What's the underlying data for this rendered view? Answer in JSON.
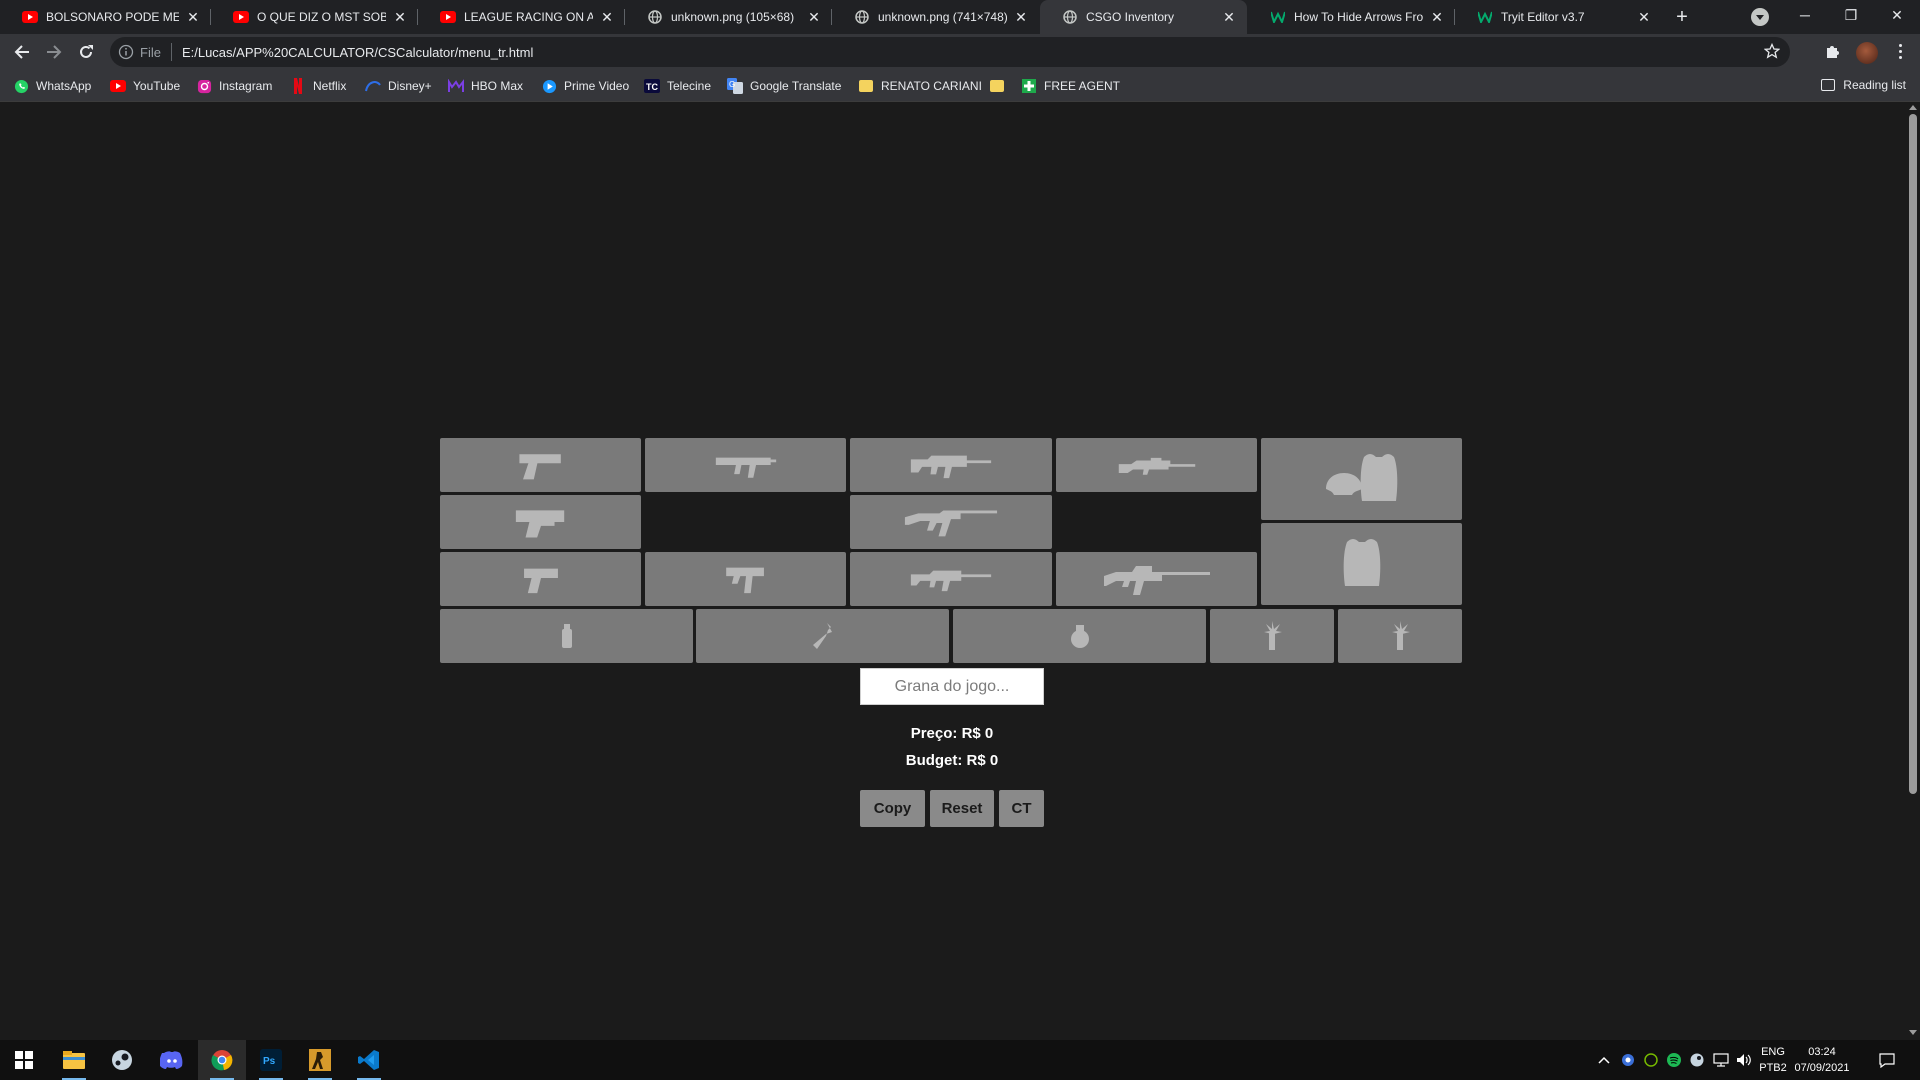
{
  "browser": {
    "tabs": [
      {
        "title": "BOLSONARO PODE MESMO",
        "favicon": "youtube-icon"
      },
      {
        "title": "O QUE DIZ O MST SOBRE O",
        "favicon": "youtube-icon"
      },
      {
        "title": "LEAGUE RACING ON A WE",
        "favicon": "youtube-icon"
      },
      {
        "title": "unknown.png (105×68)",
        "favicon": "globe-icon"
      },
      {
        "title": "unknown.png (741×748)",
        "favicon": "globe-icon"
      },
      {
        "title": "CSGO Inventory",
        "favicon": "globe-icon",
        "active": true
      },
      {
        "title": "How To Hide Arrows From",
        "favicon": "w-icon"
      },
      {
        "title": "Tryit Editor v3.7",
        "favicon": "w-icon"
      }
    ],
    "address": {
      "scheme": "File",
      "url": "E:/Lucas/APP%20CALCULATOR/CSCalculator/menu_tr.html"
    },
    "bookmarks": [
      {
        "label": "WhatsApp",
        "icon": "whatsapp-icon"
      },
      {
        "label": "YouTube",
        "icon": "youtube-icon"
      },
      {
        "label": "Instagram",
        "icon": "instagram-icon"
      },
      {
        "label": "Netflix",
        "icon": "netflix-icon"
      },
      {
        "label": "Disney+",
        "icon": "disney-icon"
      },
      {
        "label": "HBO Max",
        "icon": "hbo-icon"
      },
      {
        "label": "Prime Video",
        "icon": "prime-icon"
      },
      {
        "label": "Telecine",
        "icon": "telecine-icon"
      },
      {
        "label": "Google Translate",
        "icon": "translate-icon"
      },
      {
        "label": "RENATO CARIANI",
        "icon": "folder-icon"
      },
      {
        "label": "",
        "icon": "folder-icon"
      },
      {
        "label": "FREE AGENT",
        "icon": "cross-icon"
      }
    ],
    "reading_list": "Reading list"
  },
  "app": {
    "money_placeholder": "Grana do jogo...",
    "price_label": "Preço: R$ 0",
    "budget_label": "Budget: R$ 0",
    "buttons": {
      "copy": "Copy",
      "reset": "Reset",
      "team": "CT"
    },
    "slot_icons": [
      "pistol-icon",
      "smg-icon",
      "rifle-icon",
      "sniper-rifle-icon",
      "helmet-and-vest-icon",
      "heavy-pistol-icon",
      "ak47-icon",
      "kevlar-vest-icon",
      "compact-pistol-icon",
      "uzi-icon",
      "carbine-icon",
      "machine-gun-icon",
      "smoke-grenade-icon",
      "molotov-icon",
      "he-grenade-icon",
      "flashbang-icon",
      "flashbang-icon"
    ]
  },
  "taskbar": {
    "apps": [
      "windows-start-icon",
      "file-explorer-icon",
      "steam-icon",
      "discord-icon",
      "chrome-icon",
      "photoshop-icon",
      "csgo-icon",
      "vscode-icon"
    ],
    "language": [
      "ENG",
      "PTB2"
    ],
    "time": "03:24",
    "date": "07/09/2021"
  },
  "colors": {
    "page_bg": "#1b1b1b",
    "slot_bg": "#7a7a7a",
    "slot_icon": "#b7b7b7",
    "button_bg": "#8a8a8a"
  }
}
